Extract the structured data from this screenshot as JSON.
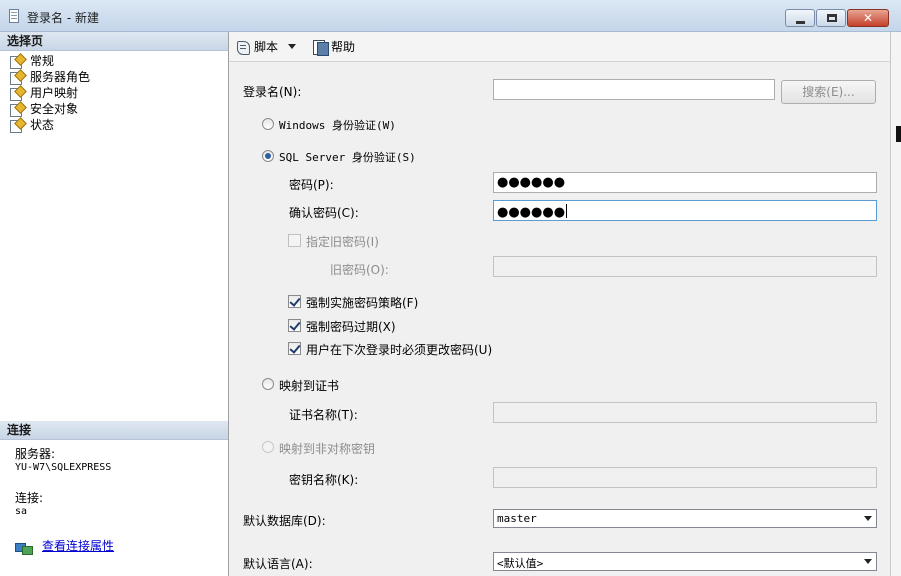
{
  "window": {
    "title": "登录名 - 新建",
    "min_label": "",
    "close_label": "✕"
  },
  "left": {
    "pages_header": "选择页",
    "pages": [
      {
        "label": "常规"
      },
      {
        "label": "服务器角色"
      },
      {
        "label": "用户映射"
      },
      {
        "label": "安全对象"
      },
      {
        "label": "状态"
      }
    ],
    "connection_header": "连接",
    "server_label": "服务器:",
    "server_value": "YU-W7\\SQLEXPRESS",
    "connection_label": "连接:",
    "connection_value": "sa",
    "view_props_link": "查看连接属性"
  },
  "toolbar": {
    "script_label": "脚本",
    "help_label": "帮助"
  },
  "form": {
    "login_name_label": "登录名(N):",
    "login_name_value": "",
    "search_button": "搜索(E)...",
    "windows_auth_label": "Windows 身份验证(W)",
    "sql_auth_label": "SQL Server 身份验证(S)",
    "password_label": "密码(P):",
    "password_value": "●●●●●●",
    "confirm_label": "确认密码(C):",
    "confirm_value": "●●●●●●",
    "specify_old_label": "指定旧密码(I)",
    "old_password_label": "旧密码(O):",
    "enforce_policy_label": "强制实施密码策略(F)",
    "enforce_expiration_label": "强制密码过期(X)",
    "must_change_label": "用户在下次登录时必须更改密码(U)",
    "map_cert_label": "映射到证书",
    "cert_name_label": "证书名称(T):",
    "map_key_label": "映射到非对称密钥",
    "key_name_label": "密钥名称(K):",
    "default_db_label": "默认数据库(D):",
    "default_db_value": "master",
    "default_lang_label": "默认语言(A):",
    "default_lang_value": "<默认值>"
  }
}
